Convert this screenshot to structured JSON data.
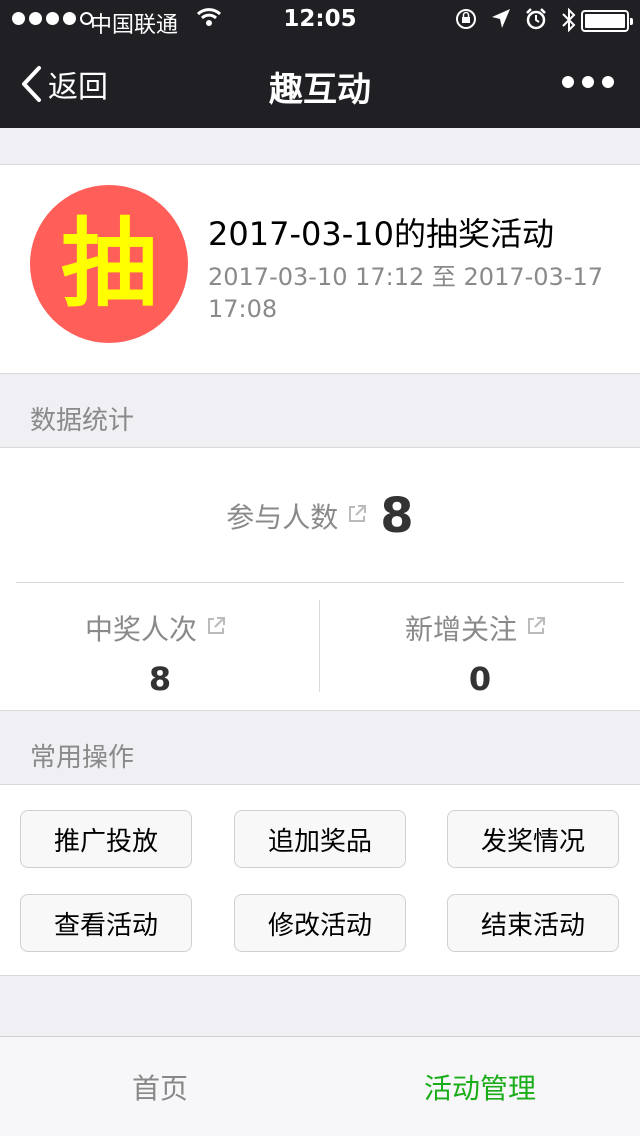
{
  "status_bar": {
    "carrier": "中国联通",
    "time": "12:05",
    "signal_bars_filled": 4,
    "signal_bars_total": 5,
    "battery_level": 1.0
  },
  "nav": {
    "back_label": "返回",
    "title": "趣互动"
  },
  "activity": {
    "avatar_text": "抽",
    "title": "2017-03-10的抽奖活动",
    "time_range": "2017-03-10 17:12 至 2017-03-17 17:08"
  },
  "stats_section": {
    "title": "数据统计",
    "participants_label": "参与人数",
    "participants_value": "8",
    "winners_label": "中奖人次",
    "winners_value": "8",
    "new_follows_label": "新增关注",
    "new_follows_value": "0"
  },
  "ops_section": {
    "title": "常用操作",
    "buttons": [
      "推广投放",
      "追加奖品",
      "发奖情况",
      "查看活动",
      "修改活动",
      "结束活动"
    ]
  },
  "tabs": {
    "items": [
      "首页",
      "活动管理"
    ],
    "active_index": 1,
    "active_color": "#1aad19",
    "inactive_color": "#888888"
  },
  "colors": {
    "nav_background": "#1f1f24",
    "avatar_background": "#ff5f58",
    "avatar_text": "#ffff00"
  }
}
